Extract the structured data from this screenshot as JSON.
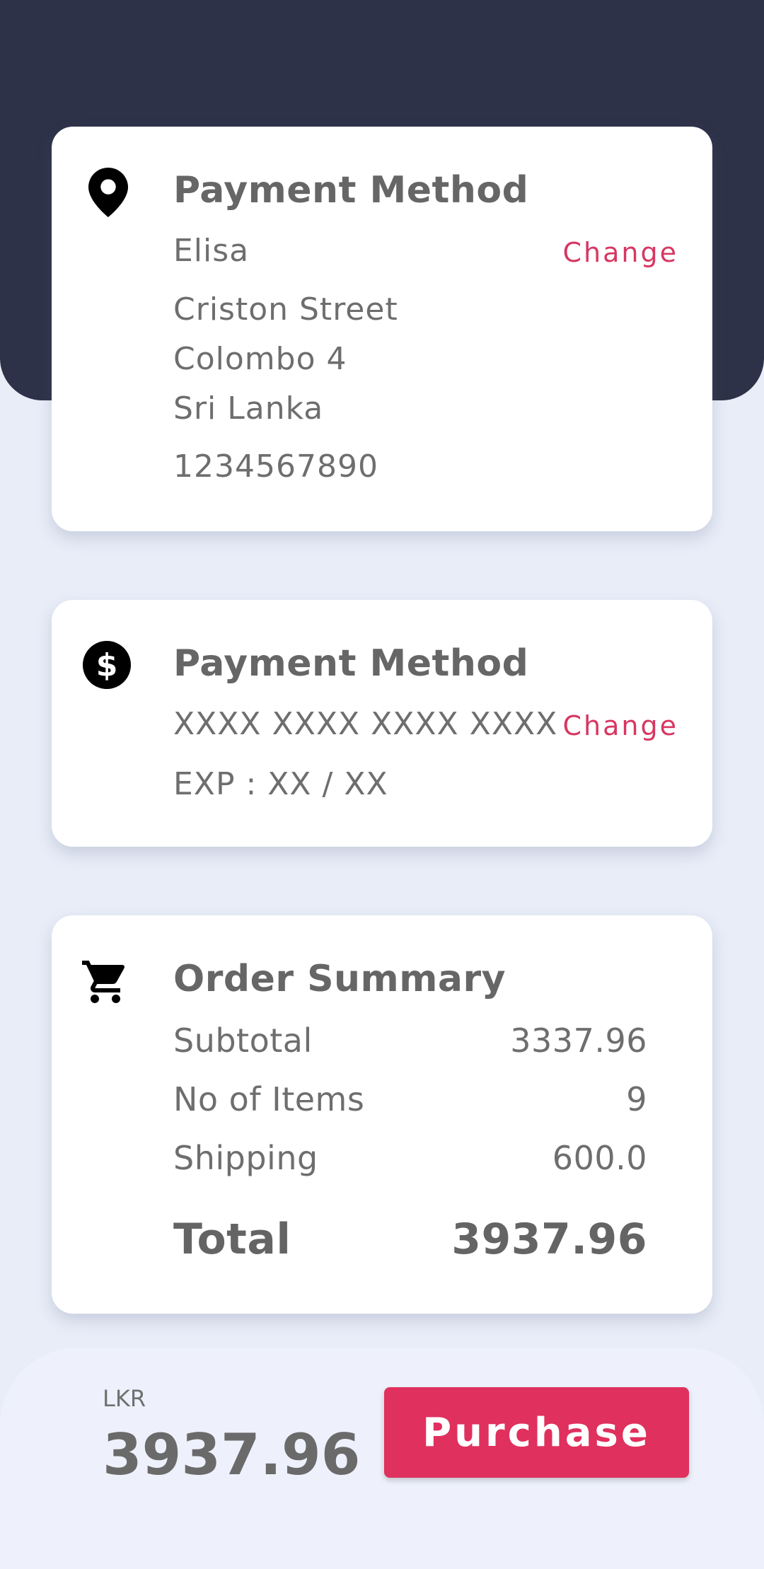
{
  "colors": {
    "header": "#2d3248",
    "background": "#e8edf8",
    "accent": "#e0305e",
    "link": "#d73762"
  },
  "address_card": {
    "icon": "location-pin-icon",
    "title": "Payment Method",
    "name": "Elisa",
    "change_label": "Change",
    "street": "Criston Street",
    "city": "Colombo 4",
    "country": "Sri Lanka",
    "phone": "1234567890"
  },
  "payment_card": {
    "icon": "dollar-circle-icon",
    "title": "Payment Method",
    "card_number": "XXXX XXXX XXXX XXXX",
    "change_label": "Change",
    "expiry": "EXP :  XX / XX"
  },
  "summary_card": {
    "icon": "cart-icon",
    "title": "Order Summary",
    "subtotal_label": "Subtotal",
    "subtotal_value": "3337.96",
    "items_label": "No of Items",
    "items_value": "9",
    "shipping_label": "Shipping",
    "shipping_value": "600.0",
    "total_label": "Total",
    "total_value": "3937.96"
  },
  "footer": {
    "currency": "LKR",
    "amount": "3937.96",
    "purchase_label": "Purchase"
  }
}
